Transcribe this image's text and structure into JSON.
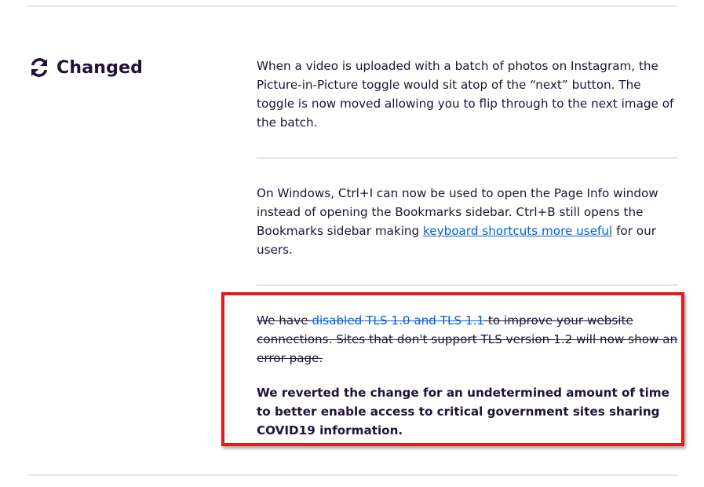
{
  "section": {
    "icon": "refresh-icon",
    "title": "Changed"
  },
  "notes": {
    "pip": "When a video is uploaded with a batch of photos on Instagram, the Picture-in-Picture toggle would sit atop of the “next” button. The toggle is now moved allowing you to flip through to the next image of the batch.",
    "shortcut_before": "On Windows, Ctrl+I can now be used to open the Page Info window instead of opening the Bookmarks sidebar. Ctrl+B still opens the Bookmarks sidebar making ",
    "shortcut_link": "keyboard shortcuts more useful",
    "shortcut_after": " for our users.",
    "tls_before": "We have ",
    "tls_link": "disabled TLS 1.0 and TLS 1.1",
    "tls_after": " to improve your website connections. Sites that don't support TLS version 1.2 will now show an error page.",
    "revert": "We reverted the change for an undetermined amount of time to better enable access to critical government sites sharing COVID19 information."
  },
  "colors": {
    "text": "#20123a",
    "link": "#0060df",
    "highlight": "#e31b1b"
  }
}
